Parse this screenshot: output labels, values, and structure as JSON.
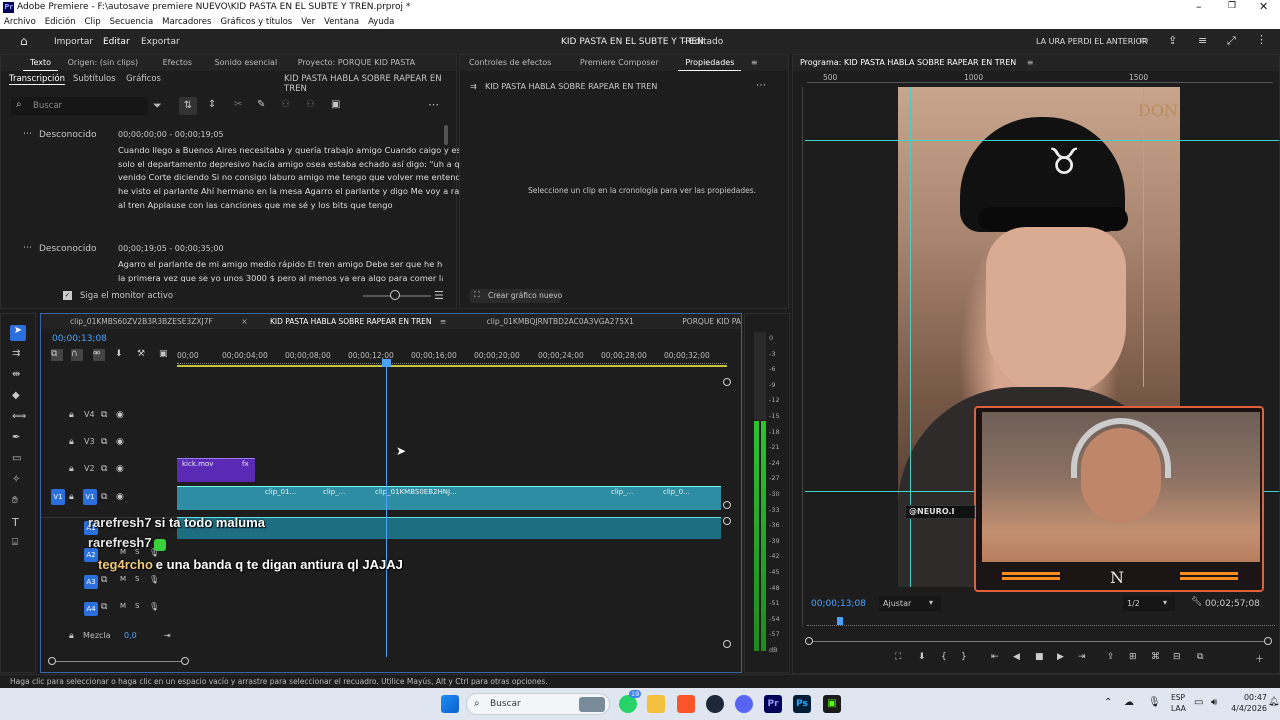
{
  "titlebar": {
    "title": "Adobe Premiere - F:\\autosave premiere NUEVO\\KID PASTA EN EL SUBTE Y TREN.prproj *"
  },
  "menu": [
    "Archivo",
    "Edición",
    "Clip",
    "Secuencia",
    "Marcadores",
    "Gráficos y títulos",
    "Ver",
    "Ventana",
    "Ayuda"
  ],
  "header": {
    "tabs": [
      "Importar",
      "Editar",
      "Exportar"
    ],
    "project_title": "KID PASTA EN EL SUBTE Y TREN",
    "status": "- Editado",
    "workspace": "LA URA PERDI EL ANTERIOR"
  },
  "left_panel": {
    "tabs": [
      "Texto",
      "Origen: (sin clips)",
      "Efectos",
      "Sonido esencial",
      "Proyecto: PORQUE KID PASTA"
    ],
    "subtabs": [
      "Transcripción",
      "Subtítulos",
      "Gráficos"
    ],
    "sequence_name": "KID PASTA HABLA SOBRE RAPEAR EN TREN",
    "search_placeholder": "Buscar",
    "segments": [
      {
        "speaker": "Desconocido",
        "time": "00;00;00;00 - 00;00;19;05",
        "lines": [
          "Cuando llego a Buenos Aires necesitaba y quería trabajo amigo Cuando caigo y estaba",
          "solo el departamento depresivo hacía amigo osea estaba echado así digo: \"uh a que",
          "venido Corte diciendo Si no consigo laburo amigo me tengo que volver me entendes",
          "he visto el parlante Ahí hermano en la mesa Agarro el parlante y digo Me voy a rapear",
          "al tren Applause con las canciones que me sé y los bits que tengo"
        ]
      },
      {
        "speaker": "Desconocido",
        "time": "00;00;19;05 - 00;00;35;00",
        "lines": [
          "Agarro el parlante de mi amigo medio rápido El tren amigo Debe ser que he hecho uno",
          "la primera vez que se yo unos 3000 $ pero al menos ya era algo para comer la noche y"
        ]
      }
    ],
    "follow_monitor": "Siga el monitor activo"
  },
  "mid_panel": {
    "tabs": [
      "Controles de efectos",
      "Premiere Composer",
      "Propiedades"
    ],
    "title": "KID PASTA HABLA SOBRE RAPEAR EN TREN",
    "message": "Seleccione un clip en la cronología para ver las propiedades.",
    "create_graphic": "Crear gráfico nuevo"
  },
  "program": {
    "title": "Programa: KID PASTA HABLA SOBRE RAPEAR EN TREN",
    "ruler": [
      "500",
      "1000",
      "1500"
    ],
    "timecode": "00;00;13;08",
    "fit": "Ajustar",
    "quality": "1/2",
    "duration": "00;02;57;08",
    "overlay_text": "DON",
    "webcam_brand": "N",
    "neuro_label": "@NEURO.I"
  },
  "timeline": {
    "tabs": [
      "clip_01KMBS60ZV2B3R3BZESE3ZXJ7F",
      "KID PASTA HABLA SOBRE RAPEAR EN TREN",
      "clip_01KMBQJRNTBD2AC0A3VGA275X1",
      "PORQUE KID PASTA"
    ],
    "timecode": "00;00;13;08",
    "ruler": [
      "00;00",
      "00;00;04;00",
      "00;00;08;00",
      "00;00;12;00",
      "00;00;16;00",
      "00;00;20;00",
      "00;00;24;00",
      "00;00;28;00",
      "00;00;32;00"
    ],
    "video_tracks": [
      "V4",
      "V3",
      "V2",
      "V1"
    ],
    "audio_tracks": [
      "A1",
      "A2",
      "A3",
      "A4"
    ],
    "mix_label": "Mezcla",
    "mix_value": "0,0",
    "clips": {
      "v2": "kick.mov",
      "v1a": "clip_01...",
      "v1b": "clip_...",
      "v1c": "clip_01KMBS0EB2HNJ...",
      "v1d": "clip_...",
      "v1e": "clip_0..."
    }
  },
  "meter": [
    "0",
    "-3",
    "-6",
    "-9",
    "-12",
    "-15",
    "-18",
    "-21",
    "-24",
    "-27",
    "-30",
    "-33",
    "-36",
    "-39",
    "-42",
    "-45",
    "-48",
    "-51",
    "-54",
    "-57",
    "dB"
  ],
  "chat": [
    {
      "user": "rarefresh7",
      "msg": "si ta todo maluma"
    },
    {
      "user": "rarefresh7",
      "msg": ""
    },
    {
      "user": "teg4rcho",
      "msg": "e una banda q te digan antiura ql JAJAJ"
    }
  ],
  "statusbar": "Haga clic para seleccionar o haga clic en un espacio vacío y arrastre para seleccionar el recuadro. Utilice Mayús, Alt y Ctrl para otras opciones.",
  "taskbar": {
    "search": "Buscar",
    "lang1": "ESP",
    "lang2": "LAA",
    "time": "00:47",
    "date": "4/4/2026",
    "badge": "19"
  }
}
